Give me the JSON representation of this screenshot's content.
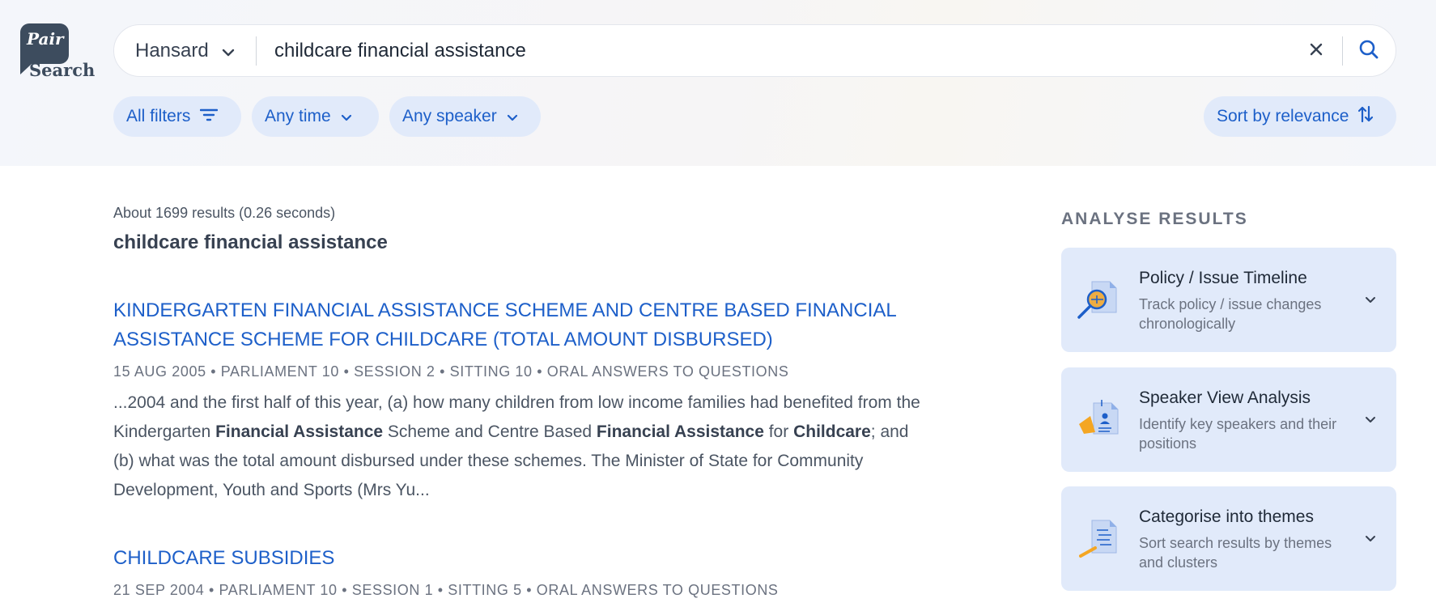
{
  "logo": {
    "pair": "Pair",
    "search": "Search"
  },
  "search": {
    "source": "Hansard",
    "query": "childcare financial assistance"
  },
  "filters": {
    "all_filters": "All filters",
    "time": "Any time",
    "speaker": "Any speaker",
    "sort": "Sort by relevance"
  },
  "results_meta": {
    "summary": "About 1699 results (0.26 seconds)",
    "query_heading": "childcare financial assistance"
  },
  "results": [
    {
      "title_line1": "KINDERGARTEN FINANCIAL ASSISTANCE SCHEME AND CENTRE BASED FINANCIAL",
      "title_line2": "ASSISTANCE SCHEME FOR CHILDCARE (TOTAL AMOUNT DISBURSED)",
      "info": "15 AUG 2005 • PARLIAMENT 10 • SESSION 2 • SITTING 10 • ORAL ANSWERS TO QUESTIONS",
      "snippet": {
        "s1": "...2004 and the first half of this year, (a) how many children from low income families had benefited from the Kindergarten ",
        "b1": "Financial Assistance",
        "s2": " Scheme and Centre Based ",
        "b2": "Financial Assistance",
        "s3": " for ",
        "b3": "Childcare",
        "s4": "; and (b) what was the total amount disbursed under these schemes. The Minister of State for Community Development, Youth and Sports (Mrs Yu..."
      }
    },
    {
      "title_line1": "CHILDCARE SUBSIDIES",
      "info": "21 SEP 2004 • PARLIAMENT 10 • SESSION 1 • SITTING 5 • ORAL ANSWERS TO QUESTIONS"
    }
  ],
  "analyse": {
    "heading": "ANALYSE RESULTS",
    "cards": [
      {
        "title": "Policy / Issue Timeline",
        "desc": "Track policy / issue changes chronologically",
        "icon": "timeline-magnifier-icon"
      },
      {
        "title": "Speaker View Analysis",
        "desc": "Identify key speakers and their positions",
        "icon": "speaker-megaphone-icon"
      },
      {
        "title": "Categorise into themes",
        "desc": "Sort search results by themes and clusters",
        "icon": "themes-document-icon"
      }
    ]
  },
  "colors": {
    "accent": "#1d5fc9",
    "chip_bg": "#e1eafa",
    "logo": "#3d4c5e",
    "orange": "#f4a623"
  }
}
